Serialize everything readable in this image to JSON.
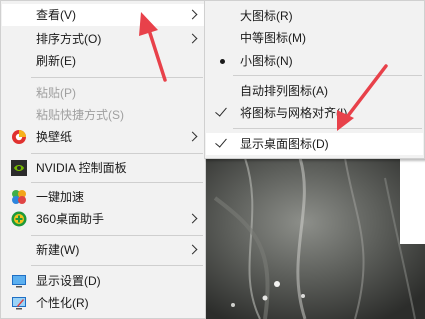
{
  "main_menu": {
    "items": [
      {
        "label": "查看(V)",
        "submenu": true,
        "highlighted": true
      },
      {
        "label": "排序方式(O)",
        "submenu": true
      },
      {
        "label": "刷新(E)"
      },
      {
        "label": "粘贴(P)",
        "disabled": true
      },
      {
        "label": "粘贴快捷方式(S)",
        "disabled": true
      },
      {
        "label": "换壁纸",
        "submenu": true,
        "icon": "wallpaper-app-icon"
      },
      {
        "label": "NVIDIA 控制面板",
        "icon": "nvidia-icon"
      },
      {
        "label": "一键加速",
        "icon": "speedup-icon"
      },
      {
        "label": "360桌面助手",
        "submenu": true,
        "icon": "360-desktop-icon"
      },
      {
        "label": "新建(W)",
        "submenu": true
      },
      {
        "label": "显示设置(D)",
        "icon": "display-settings-icon"
      },
      {
        "label": "个性化(R)",
        "icon": "personalize-icon"
      }
    ]
  },
  "view_submenu": {
    "items": [
      {
        "label": "大图标(R)"
      },
      {
        "label": "中等图标(M)"
      },
      {
        "label": "小图标(N)",
        "selected": true
      },
      {
        "label": "自动排列图标(A)"
      },
      {
        "label": "将图标与网格对齐(I)",
        "checked": true
      },
      {
        "label": "显示桌面图标(D)",
        "checked": true,
        "highlighted": true
      }
    ]
  },
  "colors": {
    "menu_bg": "#f2f2f2",
    "highlight_bg": "#ffffff",
    "disabled_text": "#a0a0a0",
    "annotation_red": "#e8414a"
  }
}
